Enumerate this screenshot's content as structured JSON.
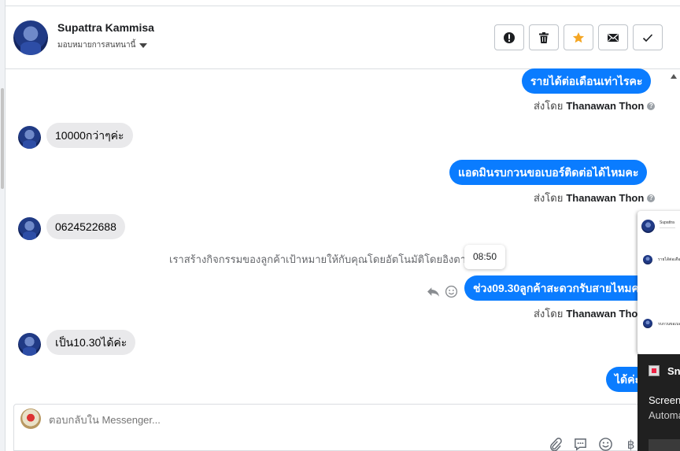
{
  "header": {
    "contact_name": "Supattra Kammisa",
    "assign_label": "มอบหมายการสนทนานี้",
    "actions": [
      {
        "name": "report-icon"
      },
      {
        "name": "trash-icon"
      },
      {
        "name": "star-icon",
        "color": "#f5a623"
      },
      {
        "name": "mail-icon"
      },
      {
        "name": "check-icon"
      }
    ]
  },
  "messages": {
    "m1": "รายได้ต่อเดือนเท่าไรคะ",
    "m1_sentby_prefix": "ส่งโดย",
    "m1_sentby_name": "Thanawan Thon",
    "m2": "10000กว่าๆค่ะ",
    "m3": "แอดมินรบกวนขอเบอร์ติดต่อได้ไหมคะ",
    "m3_sentby_prefix": "ส่งโดย",
    "m3_sentby_name": "Thanawan Thon",
    "m4": "0624522688",
    "system_note": "เราสร้างกิจกรรมของลูกค้าเป้าหมายให้กับคุณโดยอัตโนมัติโดยอิงตามการส",
    "tooltip_time": "08:50",
    "m5": "ช่วง09.30ลูกค้าสะดวกรับสายไหมคะ",
    "m5_sentby_prefix": "ส่งโดย",
    "m5_sentby_name": "Thanawan Thon",
    "m6": "เป็น10.30ได้ค่ะ",
    "m7": "ได้ค่ะ"
  },
  "composer": {
    "placeholder": "ตอบกลับใน Messenger..."
  },
  "popup": {
    "name_snippet": "Supattra",
    "item1": "รายได้ต่อเดือน",
    "item2": "รบกวนขอเบอร์"
  },
  "snip_panel": {
    "app_name": "Snipping Tool",
    "line1": "Screenshot copied",
    "line2": "Automatically saved"
  },
  "colors": {
    "accent": "#0a7cff",
    "incoming": "#e9e9eb"
  }
}
